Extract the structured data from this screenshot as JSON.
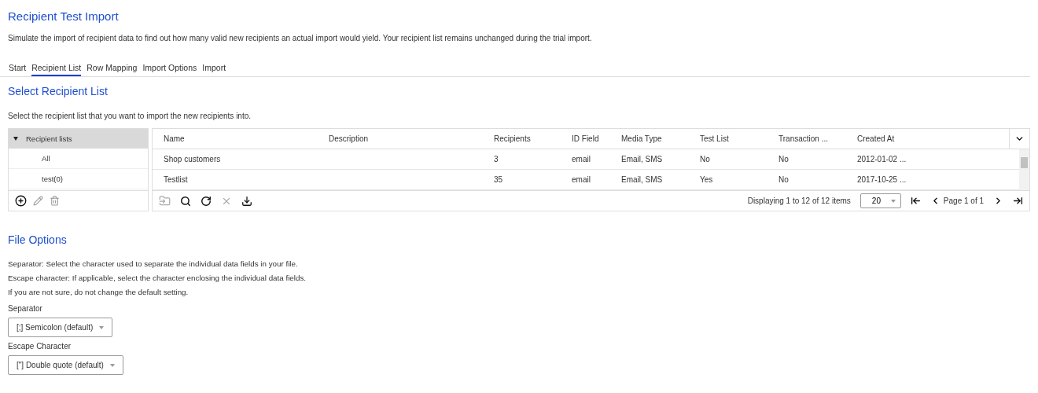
{
  "page": {
    "title": "Recipient Test Import",
    "description": "Simulate the import of recipient data to find out how many valid new recipients an actual import would yield. Your recipient list remains unchanged during the trial import."
  },
  "tabs": [
    {
      "label": "Start",
      "selected": false
    },
    {
      "label": "Recipient List",
      "selected": true
    },
    {
      "label": "Row Mapping",
      "selected": false
    },
    {
      "label": "Import Options",
      "selected": false
    },
    {
      "label": "Import",
      "selected": false
    }
  ],
  "select_section": {
    "title": "Select Recipient List",
    "description": "Select the recipient list that you want to import the new recipients into."
  },
  "tree": {
    "label": "Recipient lists",
    "expanded": true,
    "children": [
      {
        "label": "All",
        "selected": false
      },
      {
        "label": "test(0)",
        "selected": false
      }
    ]
  },
  "table": {
    "columns": [
      "Name",
      "Description",
      "Recipients",
      "ID Field",
      "Media Type",
      "Test List",
      "Transaction ...",
      "Created At"
    ],
    "rows": [
      [
        "Shop customers",
        "",
        "3",
        "email",
        "Email, SMS",
        "No",
        "No",
        "2012-01-02 ..."
      ],
      [
        "Testlist",
        "",
        "35",
        "email",
        "Email, SMS",
        "Yes",
        "No",
        "2017-10-25 ..."
      ]
    ]
  },
  "pager": {
    "summary": "Displaying 1 to 12 of 12 items",
    "page_size": "20",
    "page": "Page 1 of 1"
  },
  "file_options": {
    "title": "File Options",
    "notes": [
      "Separator: Select the character used to separate the individual data fields in your file.",
      "Escape character: If applicable, select the character enclosing the individual data fields.",
      "If you are not sure, do not change the default setting."
    ],
    "fields": [
      {
        "label": "Separator",
        "value": "[;] Semicolon (default)"
      },
      {
        "label": "Escape Character",
        "value": "[\"] Double quote (default)"
      }
    ]
  }
}
